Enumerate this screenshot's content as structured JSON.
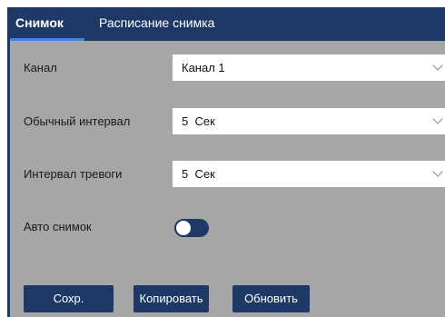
{
  "tabs": [
    {
      "label": "Снимок",
      "active": true
    },
    {
      "label": "Расписание снимка",
      "active": false
    }
  ],
  "fields": {
    "channel": {
      "label": "Канал",
      "value": "Канал 1"
    },
    "normal_interval": {
      "label": "Обычный интервал",
      "value": "5  Сек"
    },
    "alarm_interval": {
      "label": "Интервал тревоги",
      "value": "5  Сек"
    },
    "auto_snapshot": {
      "label": "Авто снимок",
      "enabled": false
    }
  },
  "buttons": {
    "save": "Сохр.",
    "copy": "Копировать",
    "refresh": "Обновить"
  },
  "colors": {
    "accent": "#1e3966",
    "tab_underline": "#3f86de",
    "panel_bg": "#a6a6a6"
  }
}
